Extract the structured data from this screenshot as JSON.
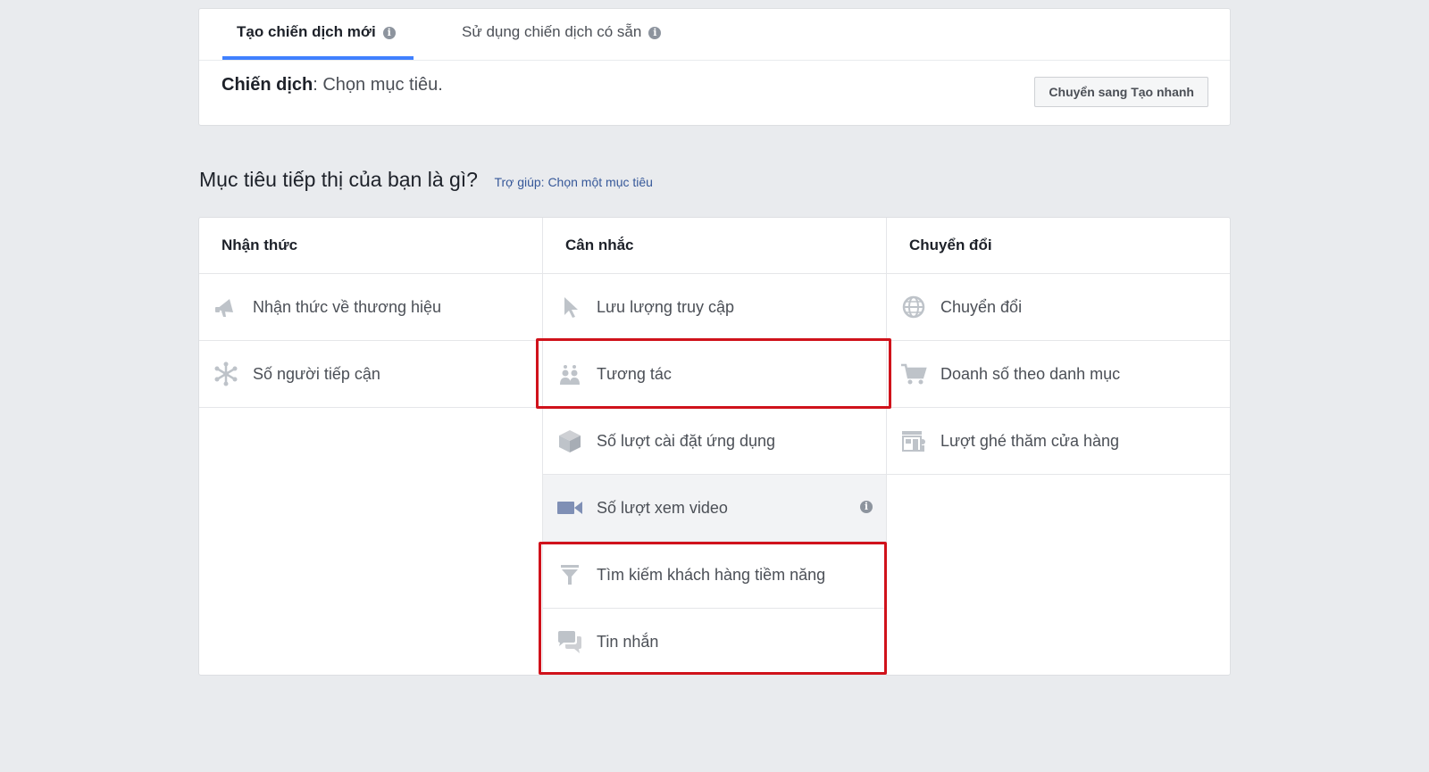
{
  "tabs": {
    "create_new": "Tạo chiến dịch mới",
    "use_existing": "Sử dụng chiến dịch có sẵn"
  },
  "campaign": {
    "label": "Chiến dịch",
    "value": ": Chọn mục tiêu."
  },
  "quick_create_button": "Chuyển sang Tạo nhanh",
  "objective_question": "Mục tiêu tiếp thị của bạn là gì?",
  "help_link": "Trợ giúp: Chọn một mục tiêu",
  "columns": [
    {
      "title": "Nhận thức",
      "items": [
        {
          "label": "Nhận thức về thương hiệu",
          "icon": "megaphone-icon"
        },
        {
          "label": "Số người tiếp cận",
          "icon": "reach-asterisk-icon"
        }
      ]
    },
    {
      "title": "Cân nhắc",
      "items": [
        {
          "label": "Lưu lượng truy cập",
          "icon": "cursor-icon"
        },
        {
          "label": "Tương tác",
          "icon": "people-icon"
        },
        {
          "label": "Số lượt cài đặt ứng dụng",
          "icon": "box-icon"
        },
        {
          "label": "Số lượt xem video",
          "icon": "video-camera-icon"
        },
        {
          "label": "Tìm kiếm khách hàng tiềm năng",
          "icon": "funnel-icon"
        },
        {
          "label": "Tin nhắn",
          "icon": "chat-bubbles-icon"
        }
      ]
    },
    {
      "title": "Chuyển đổi",
      "items": [
        {
          "label": "Chuyển đổi",
          "icon": "globe-icon"
        },
        {
          "label": "Doanh số theo danh mục",
          "icon": "cart-icon"
        },
        {
          "label": "Lượt ghé thăm cửa hàng",
          "icon": "store-icon"
        }
      ]
    }
  ],
  "colors": {
    "page_bg": "#e9ebee",
    "tab_underline": "#4080ff",
    "icon": "#bec3c9",
    "highlight": "#d0121b",
    "link": "#365899"
  }
}
